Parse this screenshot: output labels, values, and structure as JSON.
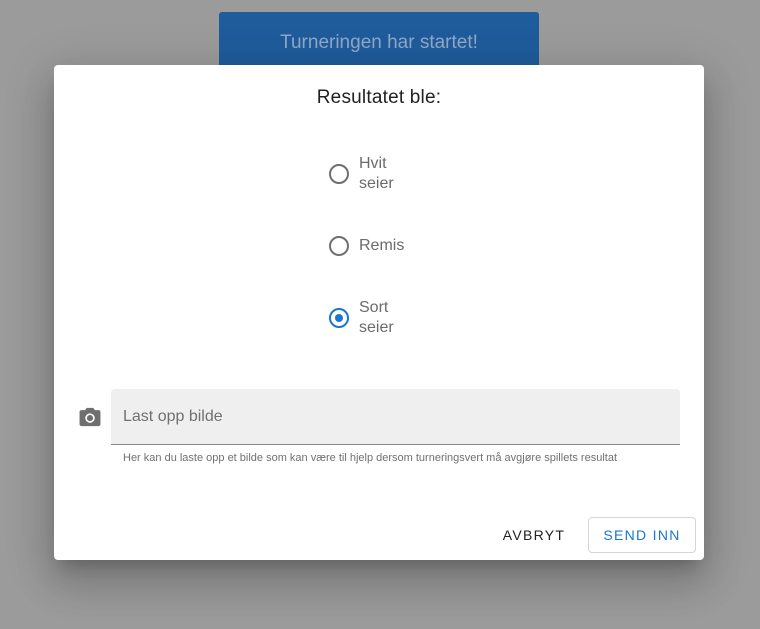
{
  "background": {
    "banner_text": "Turneringen har startet!",
    "banner_color": "#1f5c9c",
    "overlay_color": "#9b9b9b"
  },
  "dialog": {
    "title": "Resultatet ble:",
    "options": [
      {
        "label": "Hvit seier",
        "checked": false
      },
      {
        "label": "Remis",
        "checked": false
      },
      {
        "label": "Sort seier",
        "checked": true
      }
    ],
    "upload": {
      "icon": "camera-icon",
      "placeholder": "Last opp bilde",
      "helper": "Her kan du laste opp et bilde som kan være til hjelp dersom turneringsvert må avgjøre spillets resultat"
    },
    "actions": {
      "cancel_label": "AVBRYT",
      "submit_label": "SEND INN"
    },
    "accent_color": "#1976d2"
  }
}
